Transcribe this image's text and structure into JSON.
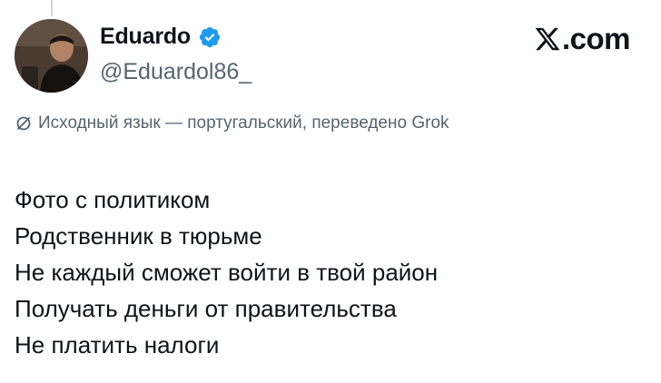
{
  "post": {
    "author": {
      "name": "Eduardo",
      "handle": "@Eduardol86_",
      "verified_icon": "verified-badge-icon",
      "verified_color": "#1d9bf0"
    },
    "brand": {
      "label": ".com",
      "logo_icon": "x-logo-icon"
    },
    "translation_note": "Исходный язык — португальский, переведено Grok",
    "translation_icon": "translate-icon",
    "lines": [
      "Фото с политиком",
      "Родственник в тюрьме",
      "Не каждый сможет войти в твой район",
      "Получать деньги от правительства",
      "Не платить налоги"
    ]
  },
  "colors": {
    "text": "#0f1419",
    "secondary_text": "#536471",
    "thread_line": "#cfd9de"
  }
}
